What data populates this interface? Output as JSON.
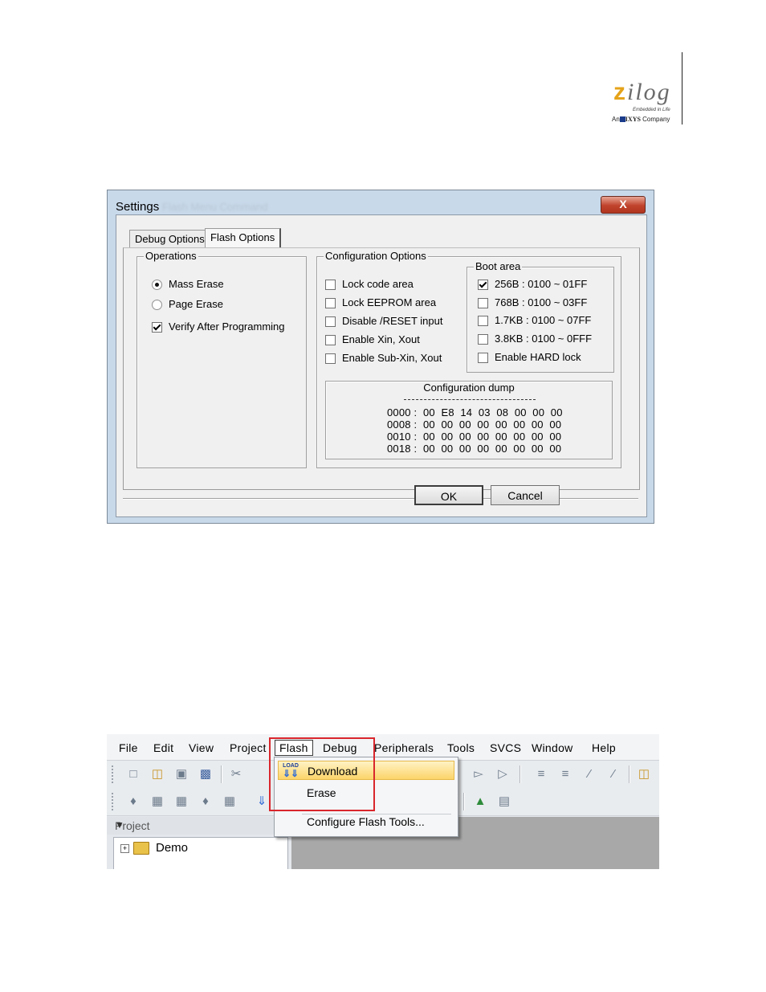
{
  "logo": {
    "word_first": "z",
    "word_rest": "ilog",
    "tagline": "Embedded in Life",
    "company_prefix": "An",
    "company_brand": "IXYS",
    "company_suffix": "Company"
  },
  "dialog": {
    "title": "Settings",
    "title_ghost": "Flash Menu Command",
    "close_label": "X",
    "tabs": [
      {
        "label": "Debug Options",
        "active": false
      },
      {
        "label": "Flash Options",
        "active": true
      }
    ],
    "operations": {
      "title": "Operations",
      "options": [
        {
          "label": "Mass Erase",
          "type": "radio",
          "checked": true
        },
        {
          "label": "Page Erase",
          "type": "radio",
          "checked": false
        },
        {
          "label": "Verify After Programming",
          "type": "checkbox",
          "checked": true
        }
      ]
    },
    "config": {
      "title": "Configuration Options",
      "options": [
        {
          "label": "Lock code area",
          "checked": false
        },
        {
          "label": "Lock EEPROM area",
          "checked": false
        },
        {
          "label": "Disable /RESET input",
          "checked": false
        },
        {
          "label": "Enable Xin, Xout",
          "checked": false
        },
        {
          "label": "Enable Sub-Xin, Xout",
          "checked": false
        }
      ]
    },
    "boot": {
      "title": "Boot area",
      "options": [
        {
          "label": "256B : 0100 ~ 01FF",
          "checked": true
        },
        {
          "label": "768B : 0100 ~ 03FF",
          "checked": false
        },
        {
          "label": "1.7KB : 0100 ~ 07FF",
          "checked": false
        },
        {
          "label": "3.8KB : 0100 ~ 0FFF",
          "checked": false
        },
        {
          "label": "Enable HARD lock",
          "checked": false
        }
      ]
    },
    "dump": {
      "title": "Configuration dump",
      "lines": [
        "0000 :  00  E8  14  03  08  00  00  00",
        "0008 :  00  00  00  00  00  00  00  00",
        "0010 :  00  00  00  00  00  00  00  00",
        "0018 :  00  00  00  00  00  00  00  00"
      ]
    },
    "ok_label": "OK",
    "cancel_label": "Cancel"
  },
  "ide": {
    "menu": [
      "File",
      "Edit",
      "View",
      "Project",
      "Flash",
      "Debug",
      "Peripherals",
      "Tools",
      "SVCS",
      "Window",
      "Help"
    ],
    "flash_menu": {
      "load_icon_text": "LOAD",
      "items": [
        "Download",
        "Erase",
        "Configure Flash Tools..."
      ]
    },
    "project_panel": {
      "title": "Project",
      "pin_icon": "pin-icon",
      "tree_root": "Demo"
    }
  }
}
